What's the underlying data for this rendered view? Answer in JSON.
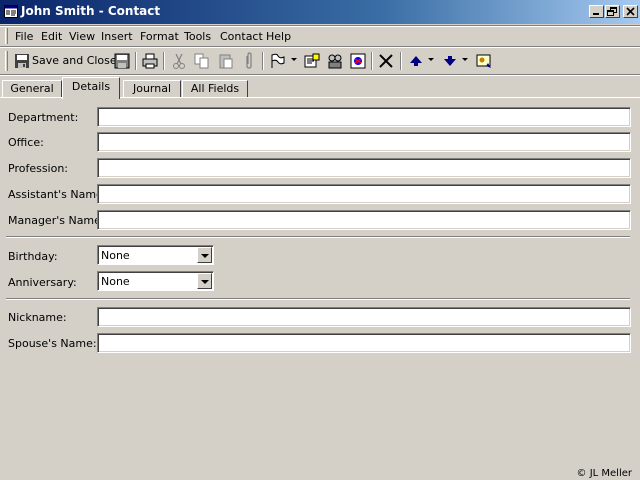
{
  "window": {
    "title": "John Smith - Contact"
  },
  "menu": [
    {
      "id": "file",
      "label": "File"
    },
    {
      "id": "edit",
      "label": "Edit"
    },
    {
      "id": "view",
      "label": "View"
    },
    {
      "id": "insert",
      "label": "Insert"
    },
    {
      "id": "format",
      "label": "Format"
    },
    {
      "id": "tools",
      "label": "Tools"
    },
    {
      "id": "contact",
      "label": "Contact"
    },
    {
      "id": "help",
      "label": "Help"
    }
  ],
  "toolbar": {
    "save_close_label": "Save and Close",
    "icons": [
      "save-close-icon",
      "save-icon",
      "print-icon",
      "cut-icon",
      "copy-icon",
      "paste-icon",
      "attach-icon",
      "flag-icon",
      "new-message-icon",
      "meeting-icon",
      "map-icon",
      "delete-icon",
      "previous-item-icon",
      "next-item-icon",
      "address-card-icon"
    ]
  },
  "tabs": [
    {
      "id": "general",
      "label": "General",
      "active": false
    },
    {
      "id": "details",
      "label": "Details",
      "active": true
    },
    {
      "id": "journal",
      "label": "Journal",
      "active": false
    },
    {
      "id": "all-fields",
      "label": "All Fields",
      "active": false
    }
  ],
  "details": {
    "department": {
      "label": "Department:",
      "value": ""
    },
    "office": {
      "label": "Office:",
      "value": ""
    },
    "profession": {
      "label": "Profession:",
      "value": ""
    },
    "assistant": {
      "label": "Assistant's Name:",
      "value": ""
    },
    "manager": {
      "label": "Manager's Name:",
      "value": ""
    },
    "birthday": {
      "label": "Birthday:",
      "value": "None"
    },
    "anniversary": {
      "label": "Anniversary:",
      "value": "None"
    },
    "nickname": {
      "label": "Nickname:",
      "value": ""
    },
    "spouse": {
      "label": "Spouse's Name:",
      "value": ""
    }
  },
  "copyright": "© JL Meller",
  "colors": {
    "window_bg": "#d4d0c8",
    "titlebar_start": "#0a246a",
    "titlebar_end": "#a6caf0"
  }
}
